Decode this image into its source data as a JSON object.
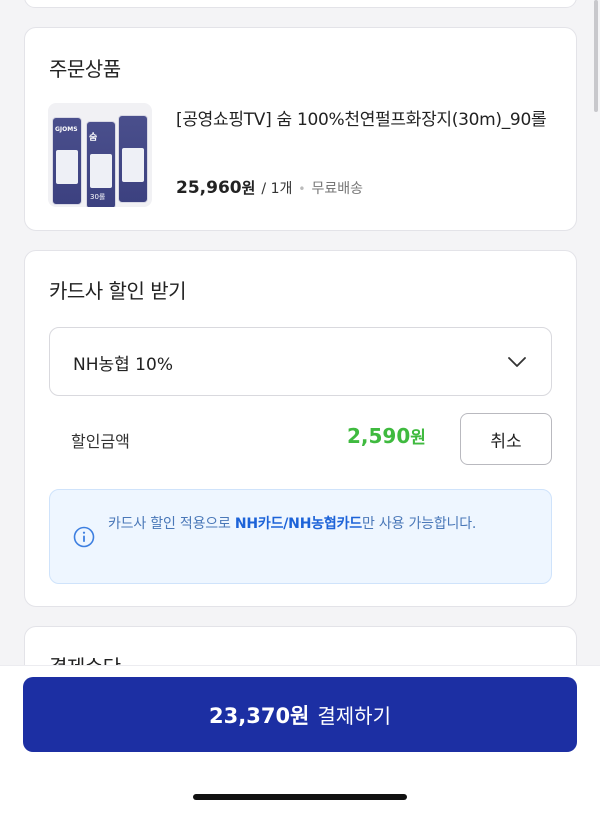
{
  "order": {
    "title": "주문상품",
    "product": {
      "name": "[공영쇼핑TV] 숨 100%천연펄프화장지(30m)_90롤",
      "price": "25,960",
      "price_unit": "원",
      "quantity": "/ 1개",
      "shipping": "무료배송",
      "thumb_label": "숨",
      "thumb_count": "30롤",
      "thumb_brand": "GJOMS"
    }
  },
  "card_discount": {
    "title": "카드사 할인 받기",
    "selected_card": "NH농협 10%",
    "discount_label": "할인금액",
    "discount_amount": "2,590",
    "discount_unit": "원",
    "cancel_label": "취소",
    "notice": {
      "prefix": "카드사 할인 적용으로 ",
      "highlight": "NH카드/NH농협카드",
      "suffix": "만 사용 가능합니다."
    }
  },
  "payment": {
    "title": "결제수단"
  },
  "pay_button": {
    "amount": "23,370원",
    "action": "결제하기"
  },
  "colors": {
    "accent": "#1c2fa3",
    "discount_green": "#3fba3f",
    "notice_bg": "#eef6ff",
    "notice_link": "#1d63d8"
  },
  "icons": [
    "chevron-down-icon",
    "info-icon"
  ]
}
